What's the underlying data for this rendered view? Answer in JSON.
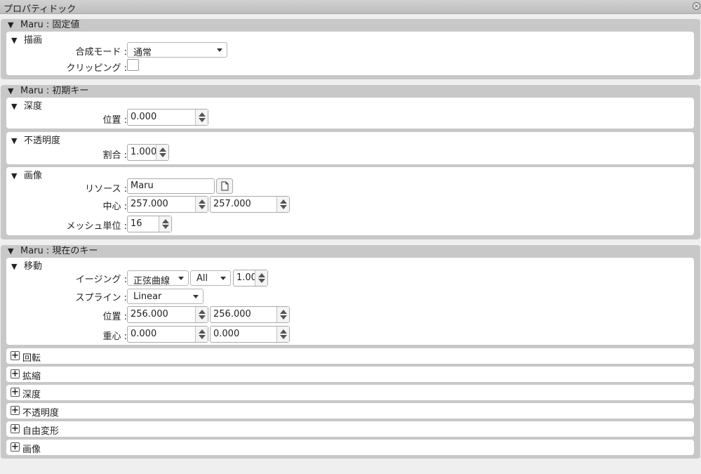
{
  "window": {
    "title": "プロパティドック"
  },
  "fixed": {
    "header": "Maru : 固定値",
    "draw": {
      "title": "描画",
      "blend_label": "合成モード :",
      "blend_value": "通常",
      "clip_label": "クリッピング :",
      "clip_checked": false
    }
  },
  "initial": {
    "header": "Maru : 初期キー",
    "depth": {
      "title": "深度",
      "pos_label": "位置 :",
      "pos_value": "0.000"
    },
    "opacity": {
      "title": "不透明度",
      "rate_label": "割合 :",
      "rate_value": "1.000"
    },
    "image": {
      "title": "画像",
      "resource_label": "リソース :",
      "resource_value": "Maru",
      "center_label": "中心 :",
      "center_x": "257.000",
      "center_y": "257.000",
      "mesh_label": "メッシュ単位 :",
      "mesh_value": "16"
    }
  },
  "current": {
    "header": "Maru : 現在のキー",
    "move": {
      "title": "移動",
      "easing_label": "イージング :",
      "easing_value": "正弦曲線",
      "easing_mode": "All",
      "easing_amount": "1.00",
      "spline_label": "スプライン :",
      "spline_value": "Linear",
      "pos_label": "位置 :",
      "pos_x": "256.000",
      "pos_y": "256.000",
      "center_label": "重心 :",
      "center_x": "0.000",
      "center_y": "0.000"
    },
    "collapsed": [
      "回転",
      "拡縮",
      "深度",
      "不透明度",
      "自由変形",
      "画像"
    ]
  }
}
